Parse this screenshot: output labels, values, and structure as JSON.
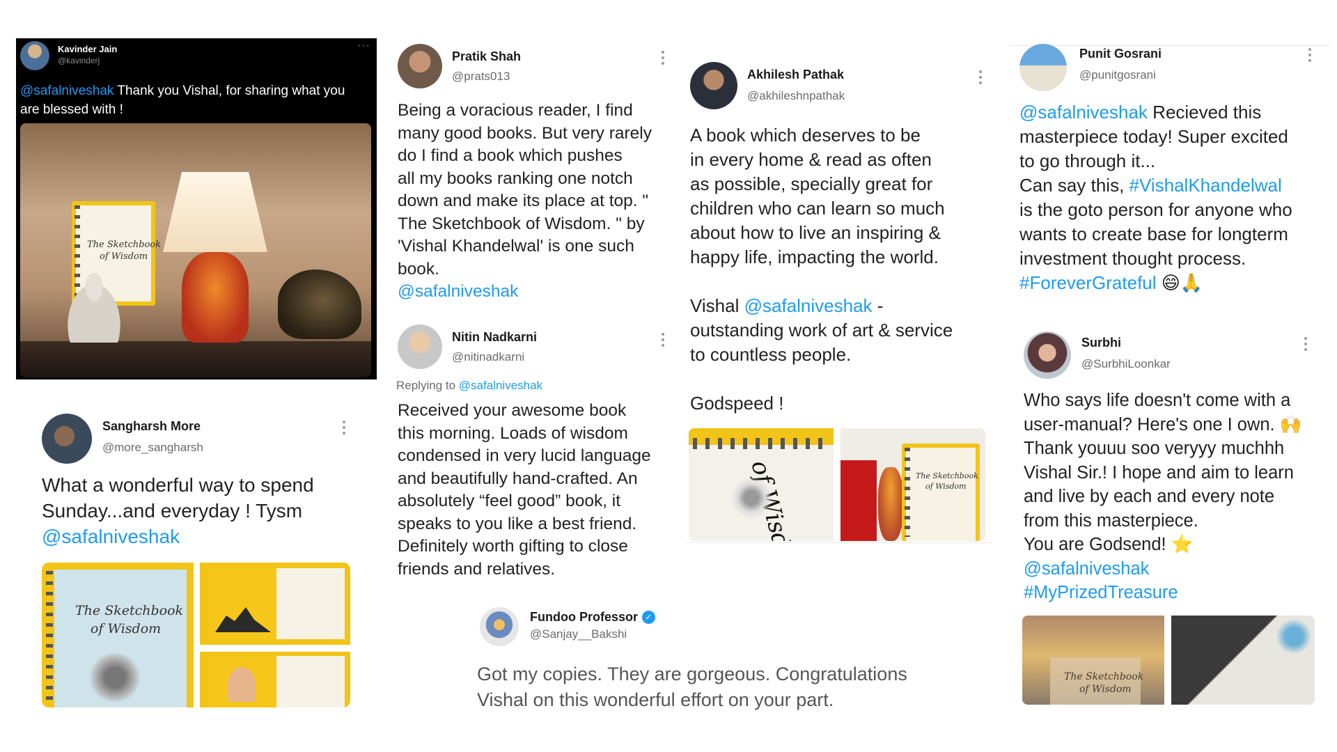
{
  "colors": {
    "link": "#1d9bf0",
    "dark_bg": "#000000",
    "book_yellow": "#f2c417"
  },
  "tweets": {
    "kavinder": {
      "name": "Kavinder Jain",
      "handle": "@kavinderj",
      "mention": "@safalniveshak",
      "line1": " Thank you Vishal, for sharing what you",
      "line2": "are blessed with !"
    },
    "pratik": {
      "name": "Pratik Shah",
      "handle": "@prats013",
      "lines": [
        "Being a voracious reader, I find",
        "many good books. But very rarely",
        "do I find a book which pushes",
        "all my books ranking one notch",
        "down and make its place at top. \"",
        "The Sketchbook of Wisdom. \" by",
        "'Vishal Khandelwal' is one such",
        "book."
      ],
      "mention": "@safalniveshak"
    },
    "akhilesh": {
      "name": "Akhilesh Pathak",
      "handle": "@akhileshnpathak",
      "lines": [
        "A book which deserves to be",
        "in every home & read as often",
        "as possible,  specially great for",
        "children who can learn so much",
        "about how to live an inspiring &",
        "happy life, impacting the world."
      ],
      "vishal_prefix": "Vishal ",
      "mention": "@safalniveshak",
      "vishal_suffix": " -",
      "line_b": "outstanding work of art & service",
      "line_c": "to countless people.",
      "godspeed": "Godspeed !"
    },
    "punit": {
      "name": "Punit Gosrani",
      "handle": "@punitgosrani",
      "mention": "@safalniveshak",
      "line1_rest": " Recieved this",
      "line2": "masterpiece today! Super excited",
      "line3": "to go through it...",
      "line4_prefix": "Can say this, ",
      "hashtag1": "#VishalKhandelwal",
      "line5": "is the goto person for anyone who",
      "line6": "wants to create base for longterm",
      "line7": "investment thought process.",
      "hashtag2": "#ForeverGrateful",
      "emoji": "😄🙏"
    },
    "sangharsh": {
      "name": "Sangharsh More",
      "handle": "@more_sangharsh",
      "line1": "What a wonderful way to spend",
      "line2": "Sunday...and everyday ! Tysm",
      "mention": "@safalniveshak"
    },
    "nitin": {
      "name": "Nitin Nadkarni",
      "handle": "@nitinadkarni",
      "replying_prefix": "Replying to ",
      "replying_to": "@safalniveshak",
      "lines": [
        "Received your awesome book",
        "this morning. Loads of wisdom",
        "condensed in very lucid language",
        "and beautifully hand-crafted. An",
        "absolutely “feel good” book, it",
        "speaks to you like a best friend.",
        "Definitely worth gifting to close",
        "friends and relatives."
      ]
    },
    "surbhi": {
      "name": "Surbhi",
      "handle": "@SurbhiLoonkar",
      "lines": [
        "Who says life doesn't come with a",
        "user-manual? Here's one I own. 🙌",
        "Thank youuu soo veryyy muchhh",
        "Vishal Sir.! I hope and aim to learn",
        "and live by each and every note",
        "from this masterpiece.",
        "You are Godsend! ⭐"
      ],
      "mention": "@safalniveshak",
      "hashtag": "#MyPrizedTreasure"
    },
    "fundoo": {
      "name": "Fundoo Professor",
      "handle": "@Sanjay__Bakshi",
      "line1": "Got my copies. They are gorgeous. Congratulations",
      "line2": "Vishal on this wonderful effort on your part."
    }
  },
  "book": {
    "title_line1": "The Sketchbook",
    "title_line2": "of Wisdom"
  }
}
